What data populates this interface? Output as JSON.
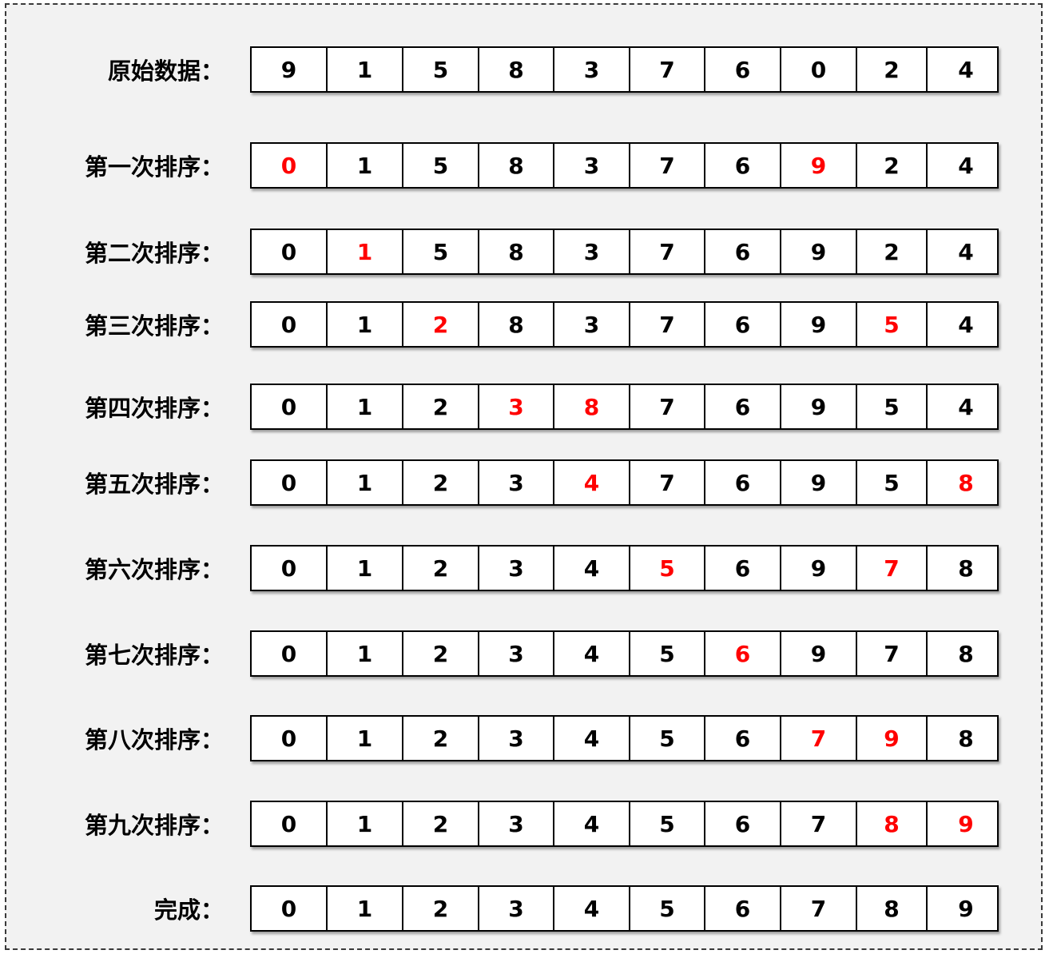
{
  "highlight_color": "#ff0000",
  "rows": [
    {
      "label": "原始数据：",
      "values": [
        "9",
        "1",
        "5",
        "8",
        "3",
        "7",
        "6",
        "0",
        "2",
        "4"
      ],
      "highlight": []
    },
    {
      "label": "第一次排序：",
      "values": [
        "0",
        "1",
        "5",
        "8",
        "3",
        "7",
        "6",
        "9",
        "2",
        "4"
      ],
      "highlight": [
        0,
        7
      ]
    },
    {
      "label": "第二次排序：",
      "values": [
        "0",
        "1",
        "5",
        "8",
        "3",
        "7",
        "6",
        "9",
        "2",
        "4"
      ],
      "highlight": [
        1
      ]
    },
    {
      "label": "第三次排序：",
      "values": [
        "0",
        "1",
        "2",
        "8",
        "3",
        "7",
        "6",
        "9",
        "5",
        "4"
      ],
      "highlight": [
        2,
        8
      ]
    },
    {
      "label": "第四次排序：",
      "values": [
        "0",
        "1",
        "2",
        "3",
        "8",
        "7",
        "6",
        "9",
        "5",
        "4"
      ],
      "highlight": [
        3,
        4
      ]
    },
    {
      "label": "第五次排序：",
      "values": [
        "0",
        "1",
        "2",
        "3",
        "4",
        "7",
        "6",
        "9",
        "5",
        "8"
      ],
      "highlight": [
        4,
        9
      ]
    },
    {
      "label": "第六次排序：",
      "values": [
        "0",
        "1",
        "2",
        "3",
        "4",
        "5",
        "6",
        "9",
        "7",
        "8"
      ],
      "highlight": [
        5,
        8
      ]
    },
    {
      "label": "第七次排序：",
      "values": [
        "0",
        "1",
        "2",
        "3",
        "4",
        "5",
        "6",
        "9",
        "7",
        "8"
      ],
      "highlight": [
        6
      ]
    },
    {
      "label": "第八次排序：",
      "values": [
        "0",
        "1",
        "2",
        "3",
        "4",
        "5",
        "6",
        "7",
        "9",
        "8"
      ],
      "highlight": [
        7,
        8
      ]
    },
    {
      "label": "第九次排序：",
      "values": [
        "0",
        "1",
        "2",
        "3",
        "4",
        "5",
        "6",
        "7",
        "8",
        "9"
      ],
      "highlight": [
        8,
        9
      ]
    },
    {
      "label": "完成：",
      "values": [
        "0",
        "1",
        "2",
        "3",
        "4",
        "5",
        "6",
        "7",
        "8",
        "9"
      ],
      "highlight": []
    }
  ]
}
